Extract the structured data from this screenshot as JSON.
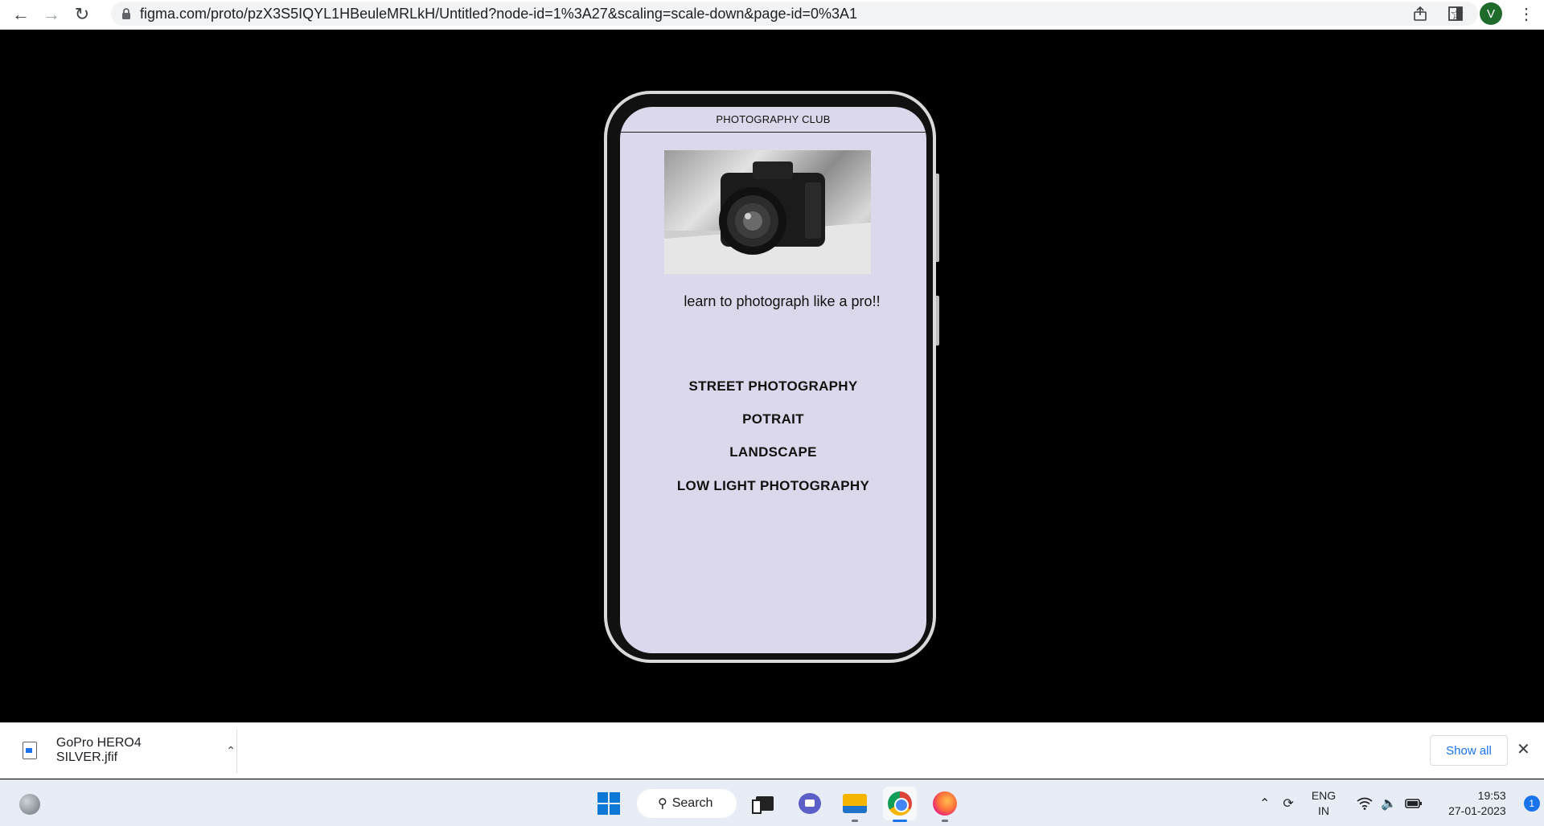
{
  "browser": {
    "url": "figma.com/proto/pzX3S5IQYL1HBeuleMRLkH/Untitled?node-id=1%3A27&scaling=scale-down&page-id=0%3A1",
    "avatar_letter": "V"
  },
  "app": {
    "title": "PHOTOGRAPHY CLUB",
    "tagline": "learn to photograph like a pro!!",
    "hero_image": "camera-photo",
    "menu": [
      {
        "label": "STREET PHOTOGRAPHY"
      },
      {
        "label": "POTRAIT"
      },
      {
        "label": "LANDSCAPE"
      },
      {
        "label": "LOW LIGHT PHOTOGRAPHY"
      }
    ],
    "colors": {
      "screen_bg": "#dad8ea",
      "stage_bg": "#000000"
    }
  },
  "downloads": {
    "file_name": "GoPro HERO4 SILVER.jfif",
    "show_all_label": "Show all"
  },
  "taskbar": {
    "search_label": "Search",
    "apps": [
      "task-view",
      "teams-chat",
      "file-explorer",
      "chrome",
      "firefox"
    ],
    "language_top": "ENG",
    "language_bottom": "IN",
    "time": "19:53",
    "date": "27-01-2023",
    "notification_count": "1"
  }
}
